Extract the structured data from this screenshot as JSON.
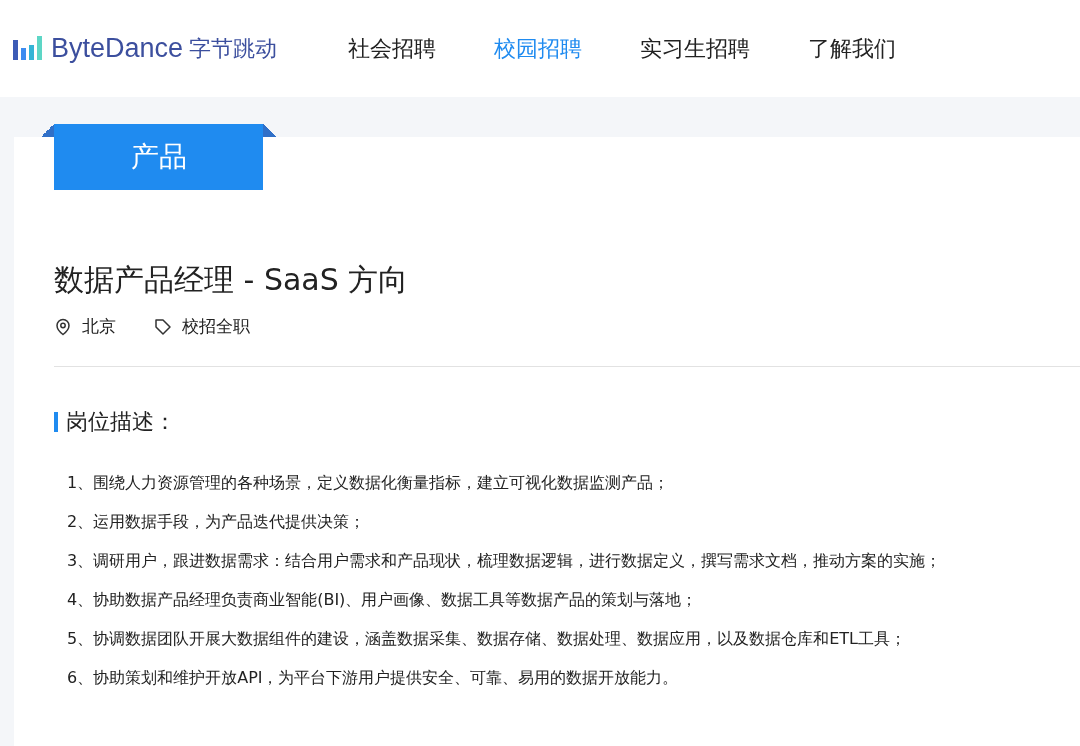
{
  "header": {
    "logo_text": "ByteDance",
    "logo_text_cn": "字节跳动",
    "nav": [
      {
        "label": "社会招聘",
        "selected": false
      },
      {
        "label": "校园招聘",
        "selected": true
      },
      {
        "label": "实习生招聘",
        "selected": false
      },
      {
        "label": "了解我们",
        "selected": false
      }
    ]
  },
  "job": {
    "category": "产品",
    "title": "数据产品经理 - SaaS 方向",
    "location": "北京",
    "type": "校招全职",
    "section_title": "岗位描述：",
    "duties": [
      "1、围绕人力资源管理的各种场景，定义数据化衡量指标，建立可视化数据监测产品；",
      "2、运用数据手段，为产品迭代提供决策；",
      "3、调研用户，跟进数据需求：结合用户需求和产品现状，梳理数据逻辑，进行数据定义，撰写需求文档，推动方案的实施；",
      "4、协助数据产品经理负责商业智能(BI)、用户画像、数据工具等数据产品的策划与落地；",
      "5、协调数据团队开展大数据组件的建设，涵盖数据采集、数据存储、数据处理、数据应用，以及数据仓库和ETL工具；",
      "6、协助策划和维护开放API，为平台下游用户提供安全、可靠、易用的数据开放能力。"
    ]
  }
}
